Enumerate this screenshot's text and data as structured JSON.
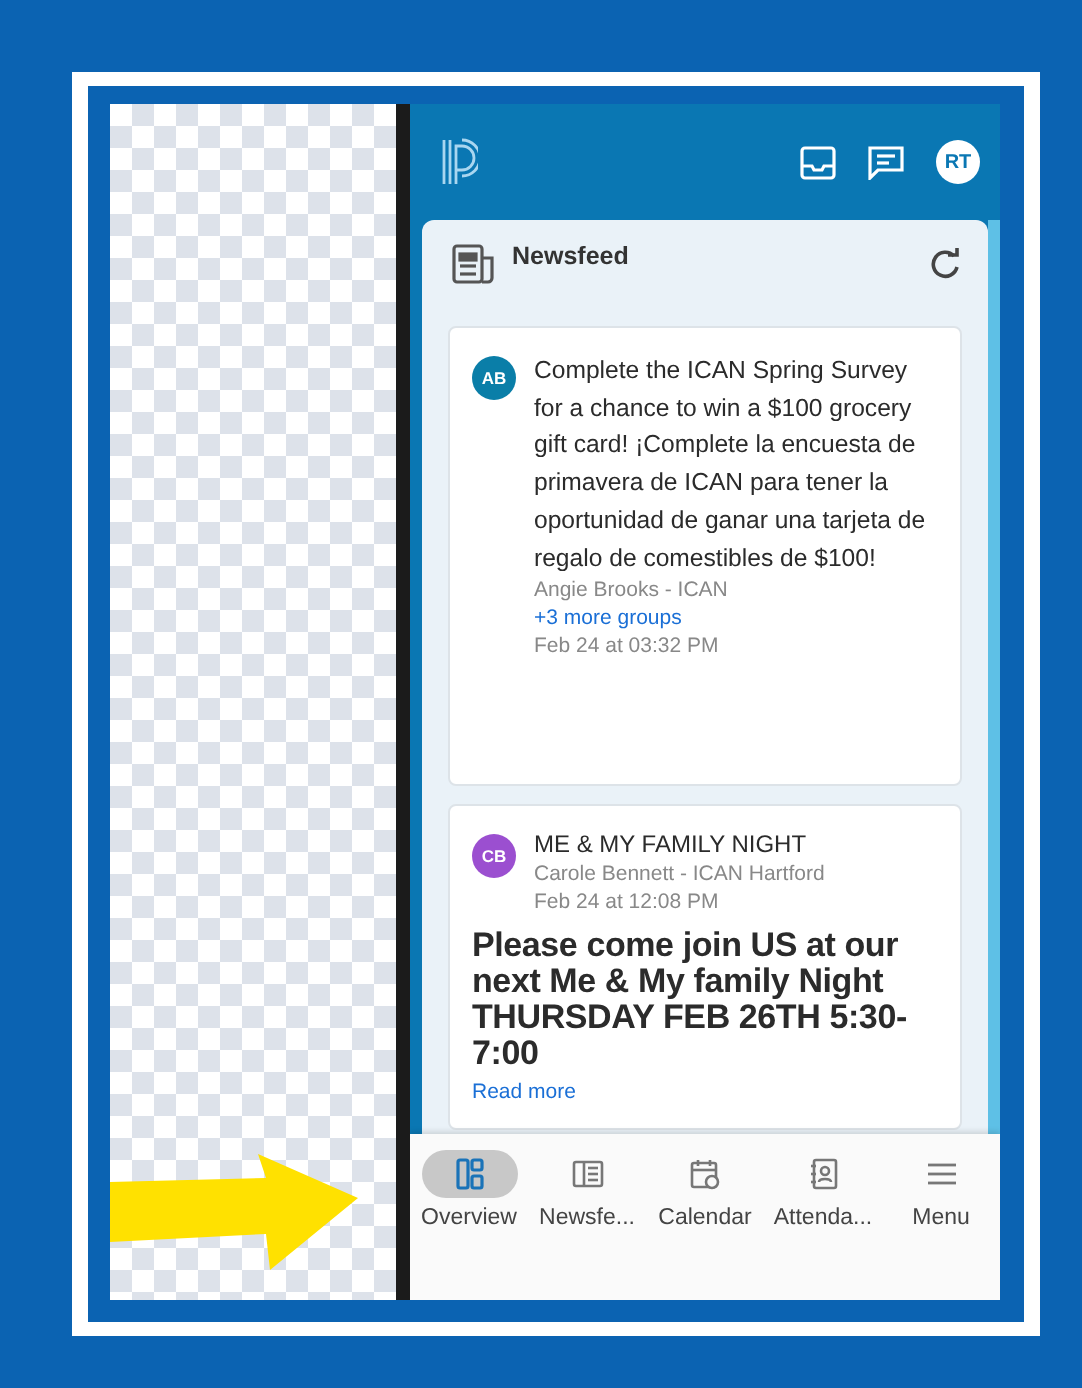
{
  "app_bar": {
    "avatar": "RT"
  },
  "newsfeed": {
    "title": "Newsfeed",
    "posts": [
      {
        "kind": "message",
        "initials": "AB",
        "color": "#0a7ea8",
        "body": "Complete the ICAN Spring Survey for a chance to win a $100 grocery gift card! ¡Complete la encuesta de primavera de ICAN para tener la oportunidad de ganar una tarjeta de regalo de comestibles de $100!",
        "author": "Angie Brooks - ICAN",
        "groups_link": "+3 more groups",
        "time": "Feb 24 at 03:32 PM"
      },
      {
        "kind": "event",
        "initials": "CB",
        "color": "#9b4fd0",
        "title": "ME & MY FAMILY NIGHT",
        "author": "Carole Bennett - ICAN Hartford",
        "time": "Feb 24 at 12:08 PM",
        "body": "Please come join US at our next Me & My family Night THURSDAY FEB 26TH 5:30-7:00",
        "read_more": "Read more"
      }
    ]
  },
  "bottom_nav": [
    {
      "kind": "overview",
      "label": "Overview",
      "selected": true
    },
    {
      "kind": "newsfeed",
      "label": "Newsfe...",
      "selected": false
    },
    {
      "kind": "calendar",
      "label": "Calendar",
      "selected": false
    },
    {
      "kind": "attendance",
      "label": "Attenda...",
      "selected": false
    },
    {
      "kind": "menu",
      "label": "Menu",
      "selected": false
    }
  ]
}
